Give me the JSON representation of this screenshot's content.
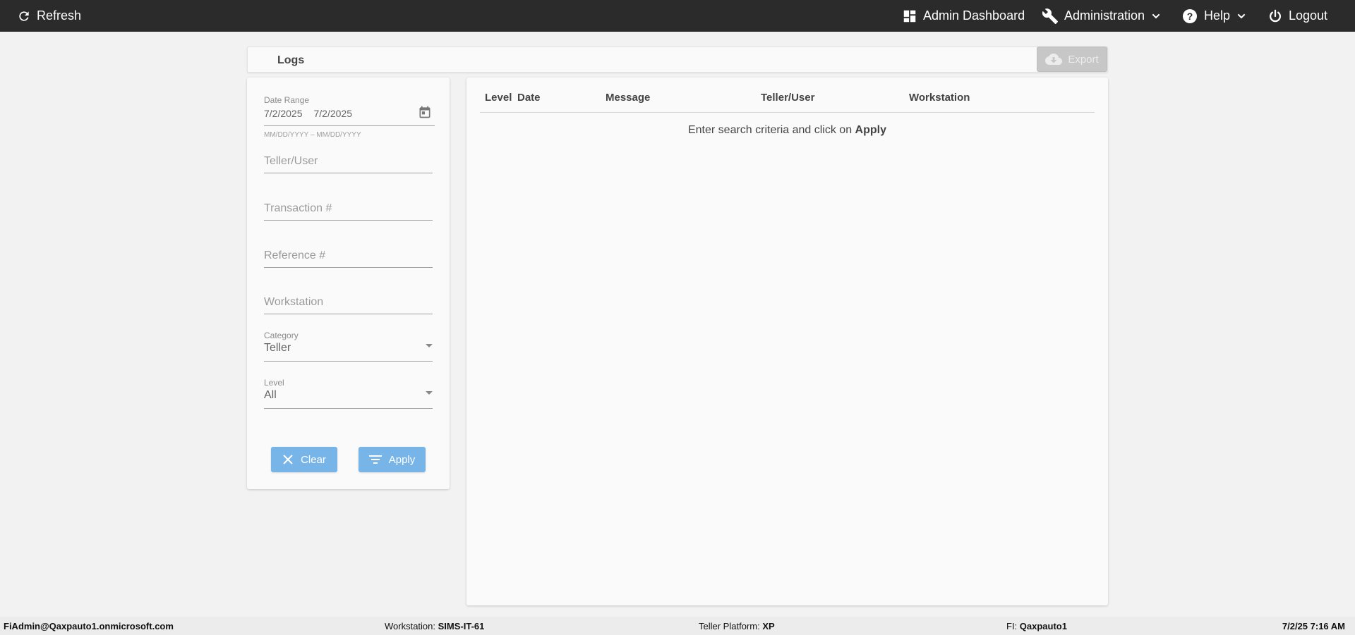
{
  "topbar": {
    "refresh": "Refresh",
    "admin_dashboard": "Admin Dashboard",
    "administration": "Administration",
    "help": "Help",
    "logout": "Logout"
  },
  "header": {
    "title": "Logs",
    "export": "Export"
  },
  "filters": {
    "date_range": {
      "label": "Date Range",
      "start": "7/2/2025",
      "end": "7/2/2025",
      "hint": "MM/DD/YYYY – MM/DD/YYYY"
    },
    "teller_user_placeholder": "Teller/User",
    "transaction_placeholder": "Transaction #",
    "reference_placeholder": "Reference #",
    "workstation_placeholder": "Workstation",
    "category": {
      "label": "Category",
      "value": "Teller"
    },
    "level": {
      "label": "Level",
      "value": "All"
    },
    "clear": "Clear",
    "apply": "Apply"
  },
  "table": {
    "columns": [
      "Level",
      "Date",
      "Message",
      "Teller/User",
      "Workstation"
    ],
    "empty_prefix": "Enter search criteria and click on",
    "empty_action": "Apply"
  },
  "statusbar": {
    "user": "FiAdmin@Qaxpauto1.onmicrosoft.com",
    "workstation_label": "Workstation:",
    "workstation": "SIMS-IT-61",
    "platform_label": "Teller Platform:",
    "platform": "XP",
    "fi_label": "FI:",
    "fi": "Qaxpauto1",
    "datetime": "7/2/25 7:16 AM"
  },
  "colors": {
    "topbar": "#2b2b2b",
    "button": "#77b5e8",
    "export_disabled": "#c7c7c7"
  },
  "icons": [
    "refresh-icon",
    "dashboard-icon",
    "wrench-icon",
    "help-icon",
    "power-icon",
    "chevron-down-icon",
    "cloud-download-icon",
    "calendar-icon",
    "close-icon",
    "filter-icon"
  ]
}
